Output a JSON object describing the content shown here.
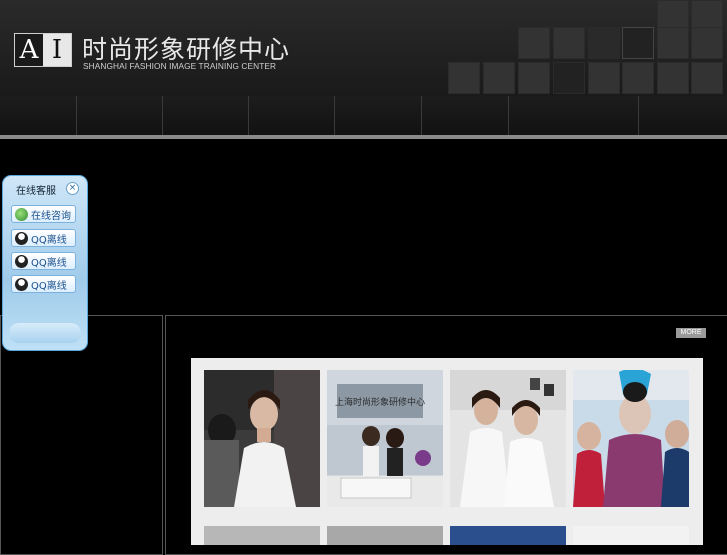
{
  "header": {
    "logo_letters": [
      "A",
      "I"
    ],
    "title_cn": "时尚形象研修中心",
    "title_en": "SHANGHAI FASHION IMAGE TRAINING CENTER"
  },
  "nav": {
    "items": [
      "",
      "",
      "",
      "",
      "",
      "",
      "",
      ""
    ]
  },
  "content": {
    "more_label": "MORE",
    "studio_sign": "上海时尚形象研修中心"
  },
  "customer_service": {
    "title": "在线客服",
    "close_symbol": "×",
    "buttons": [
      {
        "label": "在线咨询",
        "icon": "chat-user-icon"
      },
      {
        "label": "QQ离线",
        "icon": "qq-penguin-icon"
      },
      {
        "label": "QQ离线",
        "icon": "qq-penguin-icon"
      },
      {
        "label": "QQ离线",
        "icon": "qq-penguin-icon"
      }
    ]
  },
  "colors": {
    "accent_blue": "#5aa7de",
    "header_bg": "#1a1a1a",
    "panel_border": "#555555"
  }
}
